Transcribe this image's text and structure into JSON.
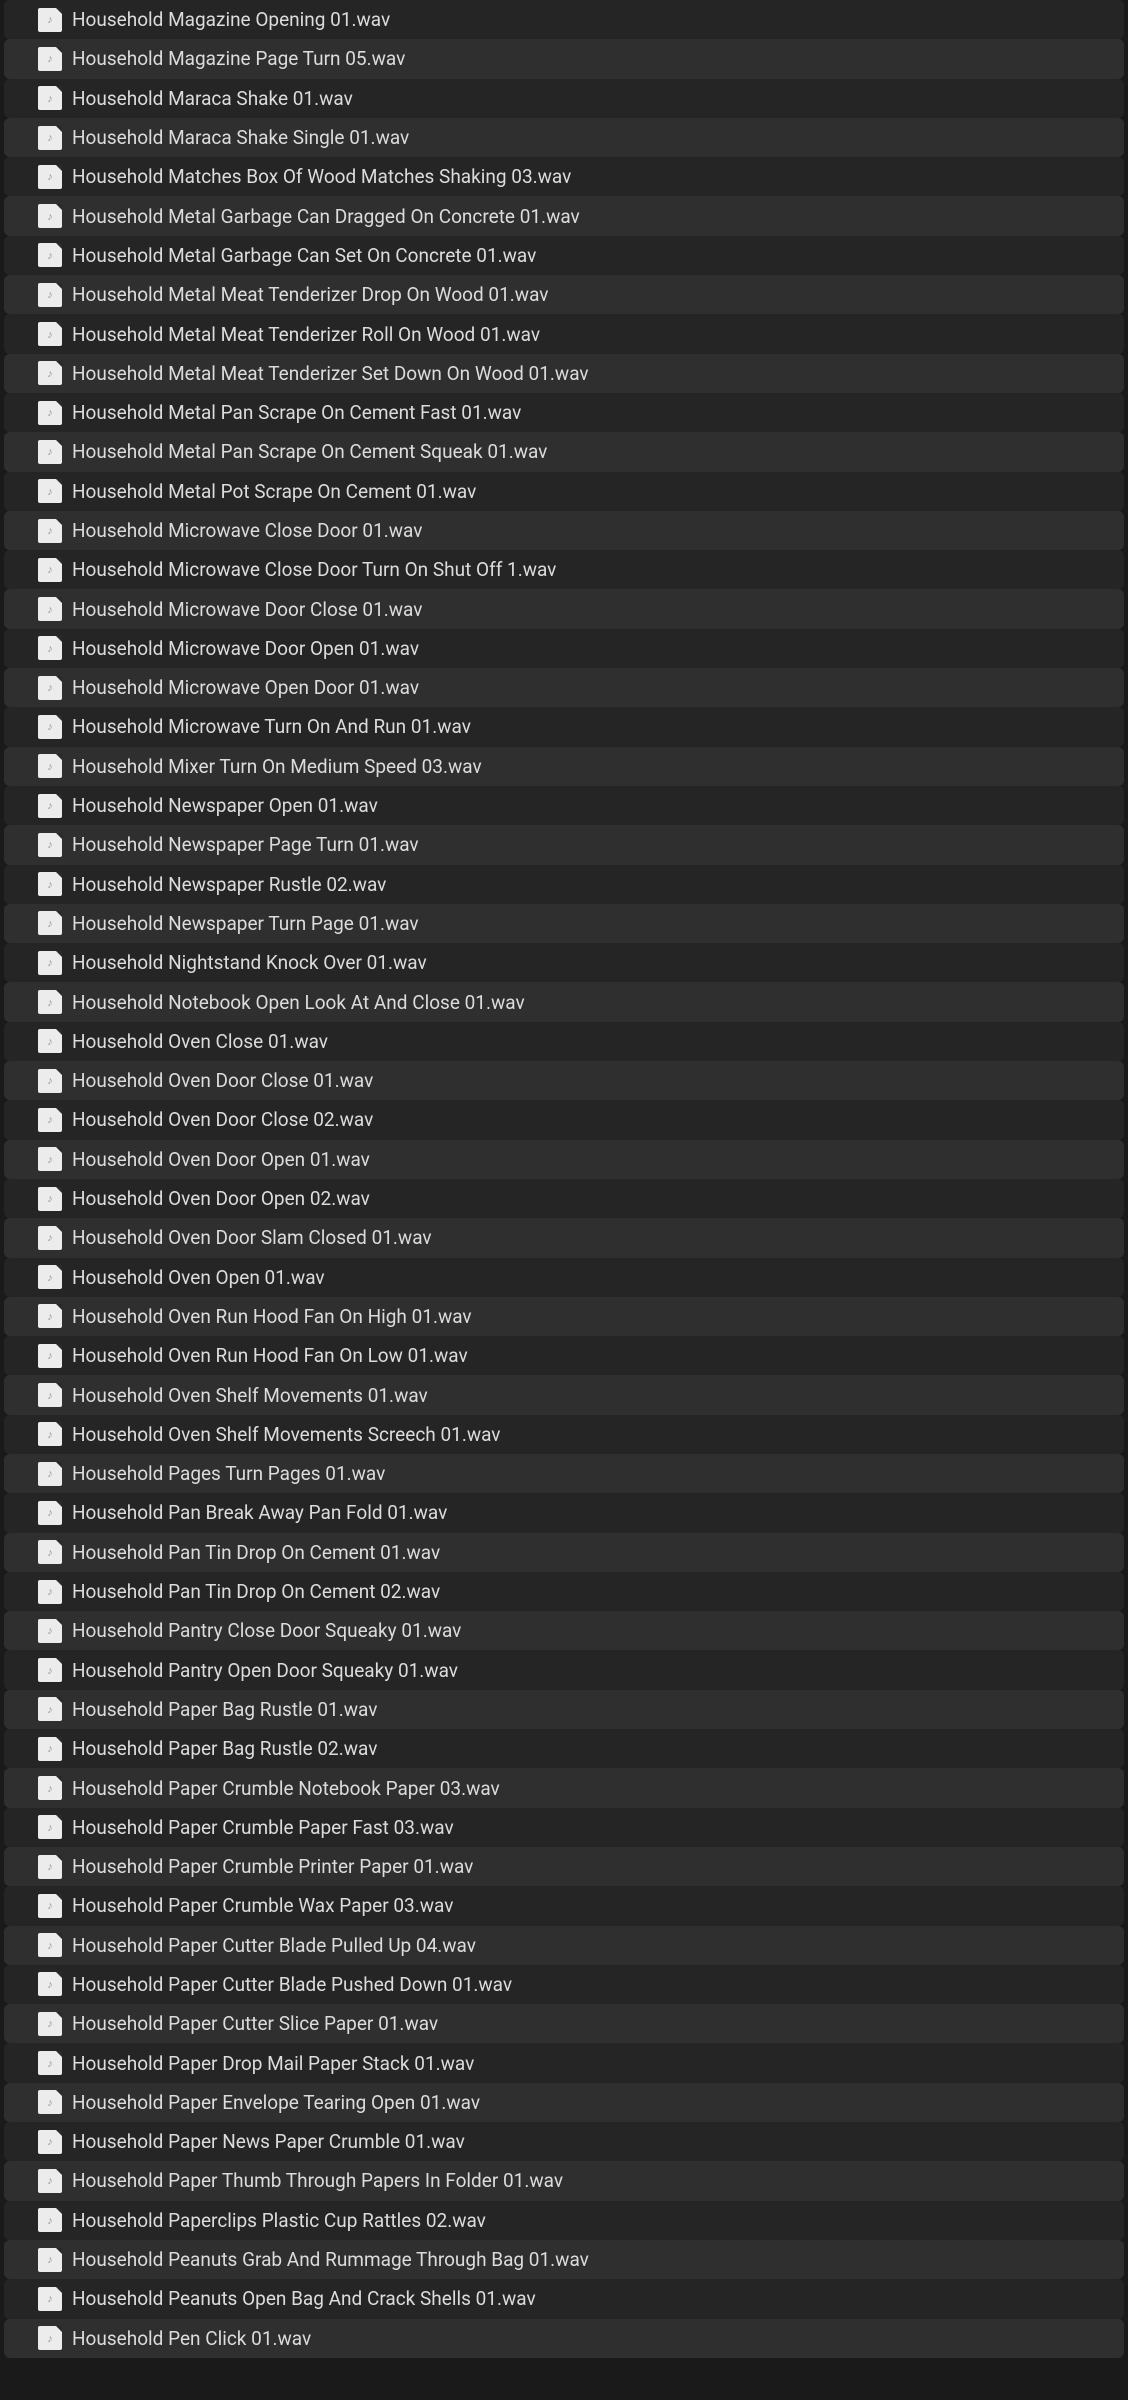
{
  "files": [
    "Household Magazine Opening 01.wav",
    "Household Magazine Page Turn 05.wav",
    "Household Maraca Shake 01.wav",
    "Household Maraca Shake Single 01.wav",
    "Household Matches Box Of Wood Matches Shaking 03.wav",
    "Household Metal Garbage Can Dragged On Concrete 01.wav",
    "Household Metal Garbage Can Set On Concrete 01.wav",
    "Household Metal Meat Tenderizer Drop On Wood 01.wav",
    "Household Metal Meat Tenderizer Roll On Wood 01.wav",
    "Household Metal Meat Tenderizer Set Down On Wood 01.wav",
    "Household Metal Pan Scrape On Cement Fast 01.wav",
    "Household Metal Pan Scrape On Cement Squeak 01.wav",
    "Household Metal Pot Scrape On Cement 01.wav",
    "Household Microwave Close Door 01.wav",
    "Household Microwave Close Door Turn On Shut Off 1.wav",
    "Household Microwave Door Close 01.wav",
    "Household Microwave Door Open 01.wav",
    "Household Microwave Open Door 01.wav",
    "Household Microwave Turn On And Run 01.wav",
    "Household Mixer Turn On Medium Speed  03.wav",
    "Household Newspaper Open 01.wav",
    "Household Newspaper Page Turn 01.wav",
    "Household Newspaper Rustle 02.wav",
    "Household Newspaper Turn Page 01.wav",
    "Household Nightstand Knock Over 01.wav",
    "Household Notebook Open Look At And Close 01.wav",
    "Household Oven Close 01.wav",
    "Household Oven Door Close 01.wav",
    "Household Oven Door Close 02.wav",
    "Household Oven Door Open 01.wav",
    "Household Oven Door Open 02.wav",
    "Household Oven Door Slam Closed 01.wav",
    "Household Oven Open 01.wav",
    "Household Oven Run Hood Fan On High  01.wav",
    "Household Oven Run Hood Fan On Low 01.wav",
    "Household Oven Shelf Movements 01.wav",
    "Household Oven Shelf Movements Screech 01.wav",
    "Household Pages Turn Pages 01.wav",
    "Household Pan Break Away Pan Fold 01.wav",
    "Household Pan Tin Drop On Cement 01.wav",
    "Household Pan Tin Drop On Cement 02.wav",
    "Household Pantry Close Door Squeaky 01.wav",
    "Household Pantry Open Door Squeaky 01.wav",
    "Household Paper Bag Rustle 01.wav",
    "Household Paper Bag Rustle 02.wav",
    "Household Paper Crumble Notebook Paper 03.wav",
    "Household Paper Crumble Paper Fast 03.wav",
    "Household Paper Crumble Printer Paper 01.wav",
    "Household Paper Crumble Wax Paper 03.wav",
    "Household Paper Cutter Blade Pulled Up 04.wav",
    "Household Paper Cutter Blade Pushed Down 01.wav",
    "Household Paper Cutter Slice Paper 01.wav",
    "Household Paper Drop Mail Paper Stack 01.wav",
    "Household Paper Envelope Tearing Open 01.wav",
    "Household Paper News Paper Crumble 01.wav",
    "Household Paper Thumb Through Papers In Folder 01.wav",
    "Household Paperclips Plastic Cup Rattles 02.wav",
    "Household Peanuts Grab And Rummage Through Bag 01.wav",
    "Household Peanuts Open Bag And Crack Shells 01.wav",
    "Household Pen Click 01.wav"
  ]
}
